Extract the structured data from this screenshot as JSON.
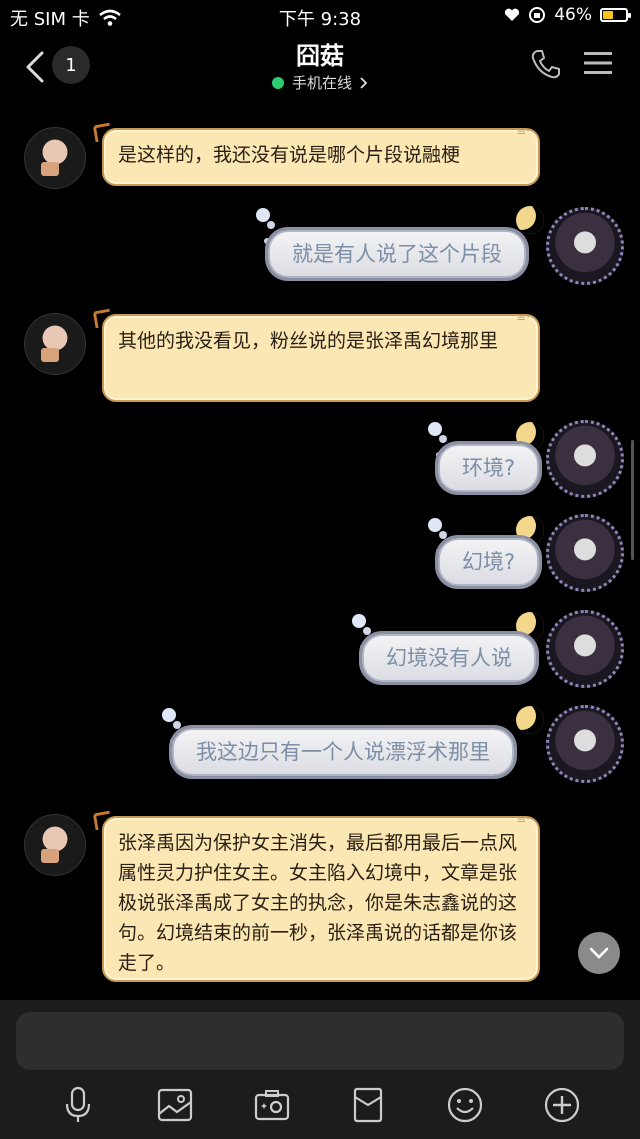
{
  "status_bar": {
    "carrier": "无 SIM 卡",
    "time": "下午 9:38",
    "battery_percent": "46%",
    "battery_level": 0.46
  },
  "header": {
    "unread_count": "1",
    "title": "囧菇",
    "status_text": "手机在线",
    "status_color": "#2ecc71"
  },
  "messages": [
    {
      "side": "left",
      "text": "是这样的，我还没有说是哪个片段说融梗"
    },
    {
      "side": "right",
      "text": "就是有人说了这个片段"
    },
    {
      "side": "left",
      "text": "其他的我没看见，粉丝说的是张泽禹幻境那里"
    },
    {
      "side": "right",
      "text": "环境?"
    },
    {
      "side": "right",
      "text": "幻境?"
    },
    {
      "side": "right",
      "text": "幻境没有人说"
    },
    {
      "side": "right",
      "text": "我这边只有一个人说漂浮术那里"
    },
    {
      "side": "left",
      "text": "张泽禹因为保护女主消失，最后都用最后一点风属性灵力护住女主。女主陷入幻境中，文章是张极说张泽禹成了女主的执念，你是朱志鑫说的这句。幻境结束的前一秒，张泽禹说的话都是你该走了。"
    }
  ],
  "composer": {
    "input_value": "",
    "tools": [
      "microphone-icon",
      "image-icon",
      "camera-icon",
      "red-packet-icon",
      "emoji-icon",
      "plus-icon"
    ]
  }
}
